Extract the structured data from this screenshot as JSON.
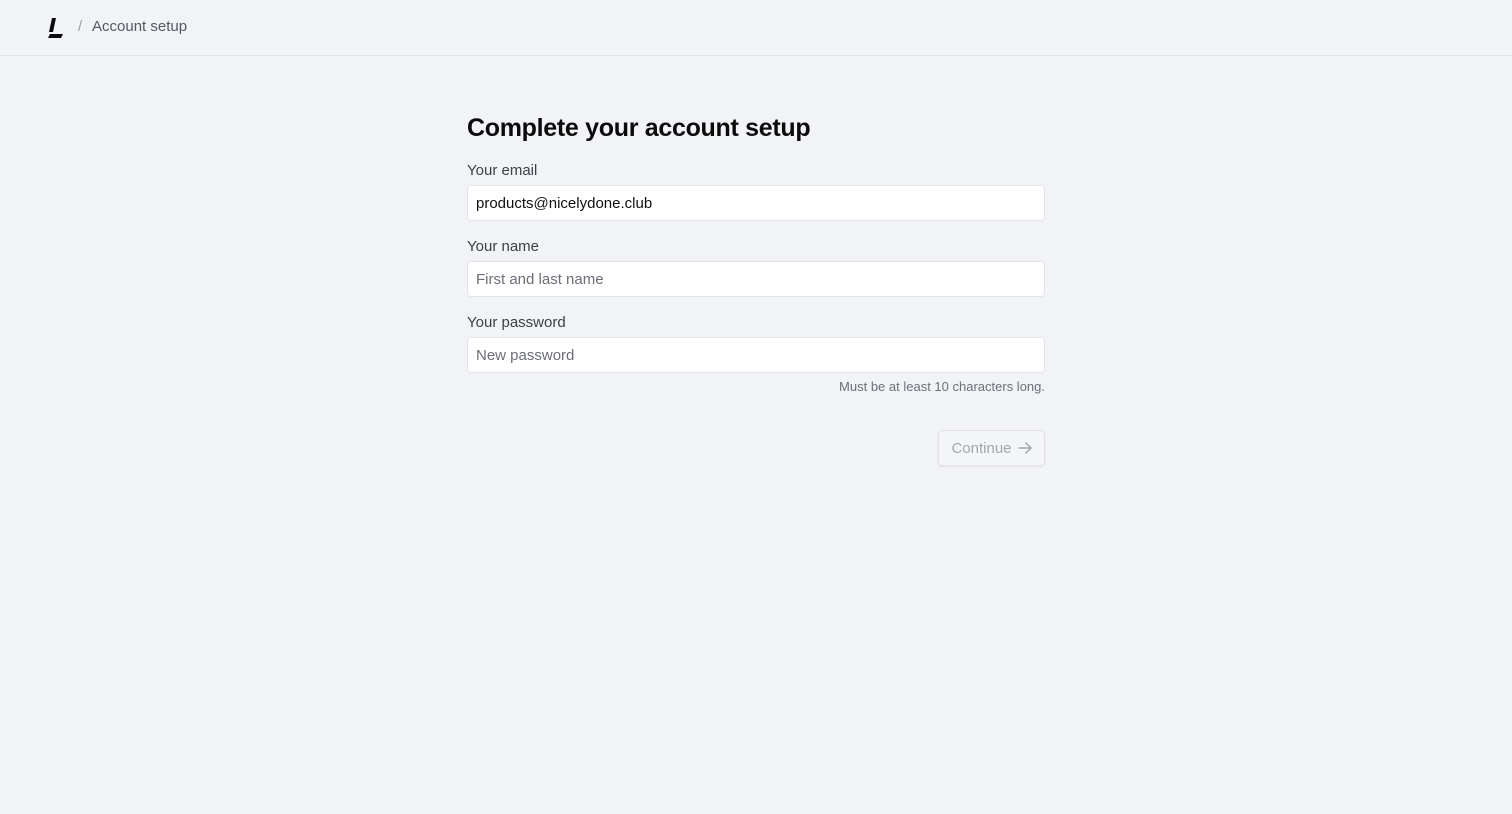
{
  "header": {
    "logo_icon": "app-logo-icon",
    "separator": "/",
    "breadcrumb_label": "Account setup"
  },
  "form": {
    "title": "Complete your account setup",
    "email": {
      "label": "Your email",
      "value": "products@nicelydone.club"
    },
    "name": {
      "label": "Your name",
      "placeholder": "First and last name",
      "value": ""
    },
    "password": {
      "label": "Your password",
      "placeholder": "New password",
      "value": "",
      "hint": "Must be at least 10 characters long."
    },
    "continue_button": {
      "label": "Continue",
      "icon": "arrow-right-icon",
      "disabled": true
    }
  },
  "colors": {
    "background": "#f2f3f6",
    "input_background": "#ffffff",
    "disabled_text": "#a4a6ad"
  }
}
